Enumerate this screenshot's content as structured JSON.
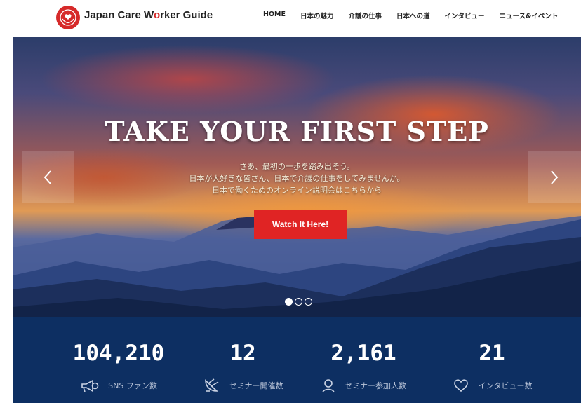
{
  "header": {
    "brand_prefix": "Japan Care W",
    "brand_highlight": "o",
    "brand_suffix": "rker Guide",
    "logo_icon": "caring-hands-heart-icon",
    "brand_color": "#d62a2a"
  },
  "nav": [
    {
      "label": "HOME"
    },
    {
      "label": "日本の魅力"
    },
    {
      "label": "介護の仕事"
    },
    {
      "label": "日本への道"
    },
    {
      "label": "インタビュー"
    },
    {
      "label": "ニュース&イベント"
    }
  ],
  "hero": {
    "title": "TAKE YOUR FIRST STEP",
    "subtitle_lines": [
      "さあ、最初の一歩を踏み出そう。",
      "日本が大好きな皆さん、日本で介護の仕事をしてみませんか。",
      "日本で働くためのオンライン説明会はこちらから"
    ],
    "cta_label": "Watch It Here!",
    "cta_color": "#e02424",
    "prev_icon": "chevron-left-icon",
    "next_icon": "chevron-right-icon",
    "slides_total": 3,
    "slide_active": 1
  },
  "stats": [
    {
      "value": "104,210",
      "label": "SNS ファン数",
      "icon": "megaphone-icon"
    },
    {
      "value": "12",
      "label": "セミナー開催数",
      "icon": "satellite-dish-icon"
    },
    {
      "value": "2,161",
      "label": "セミナー参加人数",
      "icon": "person-icon"
    },
    {
      "value": "21",
      "label": "インタビュー数",
      "icon": "heart-icon"
    }
  ],
  "stats_bg_color": "#0d2f62"
}
